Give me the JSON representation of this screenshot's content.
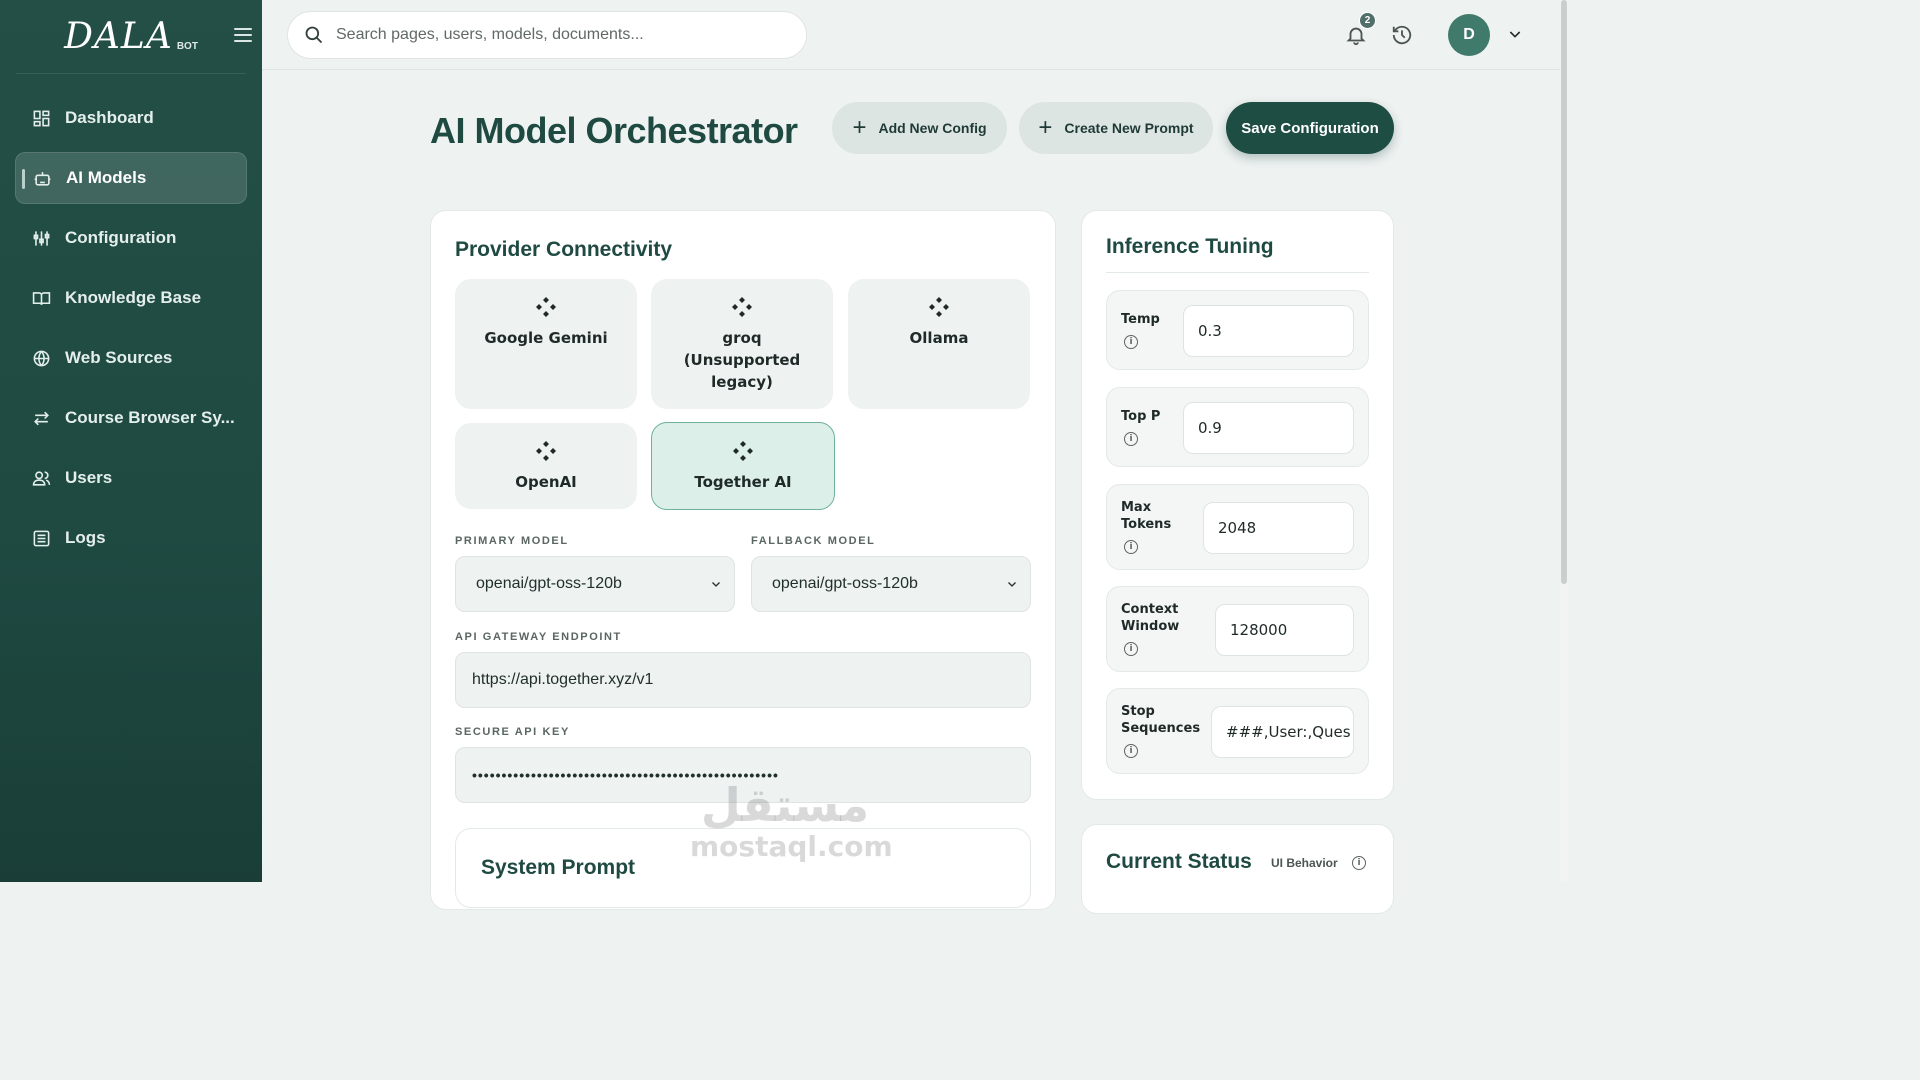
{
  "sidebar": {
    "logo": "DALA",
    "logo_sub": "BOT",
    "items": [
      {
        "label": "Dashboard",
        "icon": "dashboard-icon",
        "active": false
      },
      {
        "label": "AI Models",
        "icon": "robot-icon",
        "active": true
      },
      {
        "label": "Configuration",
        "icon": "sliders-icon",
        "active": false
      },
      {
        "label": "Knowledge Base",
        "icon": "book-icon",
        "active": false
      },
      {
        "label": "Web Sources",
        "icon": "globe-icon",
        "active": false
      },
      {
        "label": "Course Browser Sy...",
        "icon": "swap-icon",
        "active": false
      },
      {
        "label": "Users",
        "icon": "users-icon",
        "active": false
      },
      {
        "label": "Logs",
        "icon": "logs-icon",
        "active": false
      }
    ]
  },
  "topbar": {
    "search_placeholder": "Search pages, users, models, documents...",
    "notification_count": "2",
    "avatar_initial": "D"
  },
  "header": {
    "title": "AI Model Orchestrator",
    "add_config_label": "Add New Config",
    "create_prompt_label": "Create New Prompt",
    "save_label": "Save Configuration"
  },
  "provider": {
    "title": "Provider Connectivity",
    "providers": [
      {
        "name": "Google Gemini",
        "selected": false
      },
      {
        "name": "groq (Unsupported legacy)",
        "selected": false
      },
      {
        "name": "Ollama",
        "selected": false
      },
      {
        "name": "OpenAI",
        "selected": false
      },
      {
        "name": "Together AI",
        "selected": true
      }
    ],
    "primary_label": "PRIMARY MODEL",
    "primary_value": "openai/gpt-oss-120b",
    "fallback_label": "FALLBACK MODEL",
    "fallback_value": "openai/gpt-oss-120b",
    "endpoint_label": "API GATEWAY ENDPOINT",
    "endpoint_value": "https://api.together.xyz/v1",
    "key_label": "SECURE API KEY",
    "key_value": "••••••••••••••••••••••••••••••••••••••••••••••••••••"
  },
  "system_prompt": {
    "title": "System Prompt"
  },
  "tuning": {
    "title": "Inference Tuning",
    "rows": [
      {
        "label": "Temp",
        "value": "0.3"
      },
      {
        "label": "Top P",
        "value": "0.9"
      },
      {
        "label": "Max Tokens",
        "value": "2048"
      },
      {
        "label": "Context Window",
        "value": "128000"
      },
      {
        "label": "Stop Sequences",
        "value": "###,User:,Ques"
      }
    ]
  },
  "status": {
    "title": "Current Status",
    "ui_behavior_label": "UI Behavior"
  },
  "watermark": {
    "arabic": "مستقل",
    "latin": "mostaql.com"
  },
  "colors": {
    "sidebar_bg": "#234f47",
    "accent": "#1e4d44",
    "selected_provider": "#dcefe9"
  }
}
